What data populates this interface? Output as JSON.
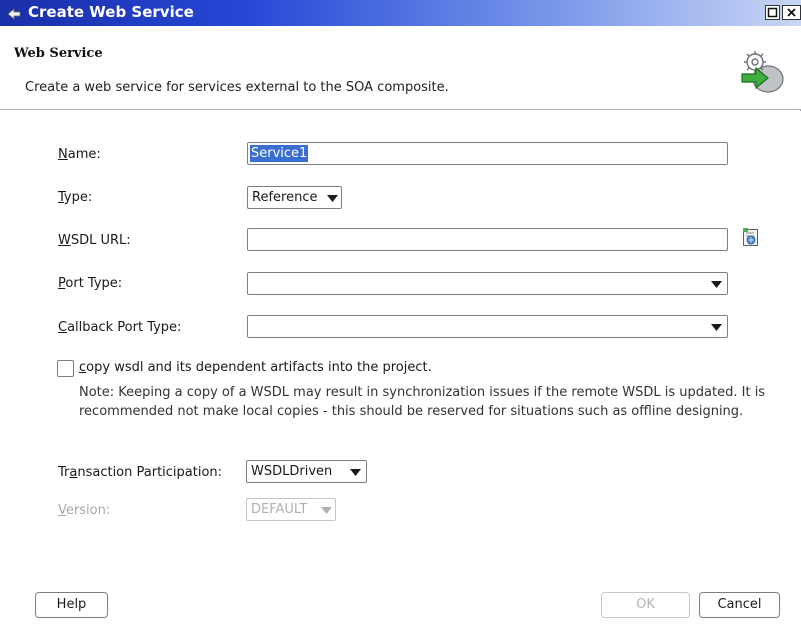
{
  "window": {
    "title": "Create Web Service"
  },
  "header": {
    "title": "Web Service",
    "description": "Create a web service for services external to the SOA composite."
  },
  "form": {
    "name": {
      "label_key": "N",
      "label_rest": "ame:",
      "value": "Service1"
    },
    "type": {
      "label_key": "T",
      "label_rest": "ype:",
      "value": "Reference"
    },
    "wsdl_url": {
      "label_key": "W",
      "label_rest": "SDL URL:",
      "value": ""
    },
    "port_type": {
      "label_key": "P",
      "label_rest": "ort Type:",
      "value": ""
    },
    "callback_port_type": {
      "label_key": "C",
      "label_rest": "allback Port Type:",
      "value": ""
    },
    "copy_wsdl": {
      "label_key": "c",
      "label_rest": "opy wsdl and its dependent artifacts into the project.",
      "checked": false
    },
    "note": "Note: Keeping a copy of a WSDL may result in synchronization issues if the remote WSDL is updated. It is recommended not make local copies - this should be reserved for situations such as offline designing.",
    "transaction": {
      "label_pre": "Tr",
      "label_key": "a",
      "label_rest": "nsaction Participation:",
      "value": "WSDLDriven"
    },
    "version": {
      "label_key": "V",
      "label_rest": "ersion:",
      "value": "DEFAULT"
    }
  },
  "buttons": {
    "help": "Help",
    "ok": "OK",
    "cancel": "Cancel"
  },
  "icons": {
    "app": "service-wizard-icon",
    "header": "web-service-gear-arrow-icon",
    "browse": "browse-wsdl-icon"
  }
}
